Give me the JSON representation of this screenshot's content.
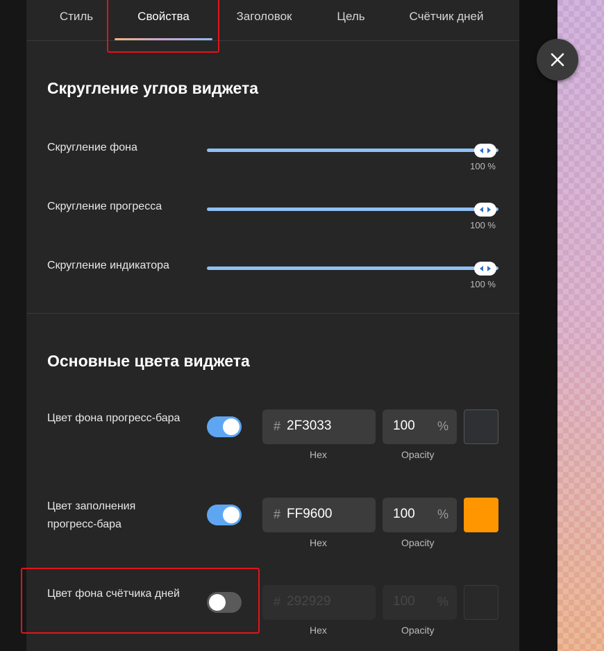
{
  "tabs": [
    {
      "label": "Стиль"
    },
    {
      "label": "Свойства"
    },
    {
      "label": "Заголовок"
    },
    {
      "label": "Цель"
    },
    {
      "label": "Счётчик дней"
    }
  ],
  "active_tab": "Свойства",
  "rounding": {
    "title": "Скругление углов виджета",
    "sliders": [
      {
        "label": "Скругление фона",
        "value_text": "100 %",
        "value": 100
      },
      {
        "label": "Скругление прогресса",
        "value_text": "100 %",
        "value": 100
      },
      {
        "label": "Скругление индикатора",
        "value_text": "100 %",
        "value": 100
      }
    ]
  },
  "colors": {
    "title": "Основные цвета виджета",
    "hex_caption": "Hex",
    "opacity_caption": "Opacity",
    "hash": "#",
    "percent": "%",
    "rows": [
      {
        "label": "Цвет фона прогресс-бара",
        "enabled": true,
        "hex": "2F3033",
        "opacity": "100",
        "swatch": "#2F3033"
      },
      {
        "label": "Цвет заполнения прогресс-бара",
        "enabled": true,
        "hex": "FF9600",
        "opacity": "100",
        "swatch": "#FF9600"
      },
      {
        "label": "Цвет фона счётчика дней",
        "enabled": false,
        "hex": "292929",
        "opacity": "100",
        "swatch": "#292929"
      }
    ]
  },
  "accent_color": "#5ea6f2",
  "highlight_color": "#e0141c",
  "close_icon": "close-icon"
}
